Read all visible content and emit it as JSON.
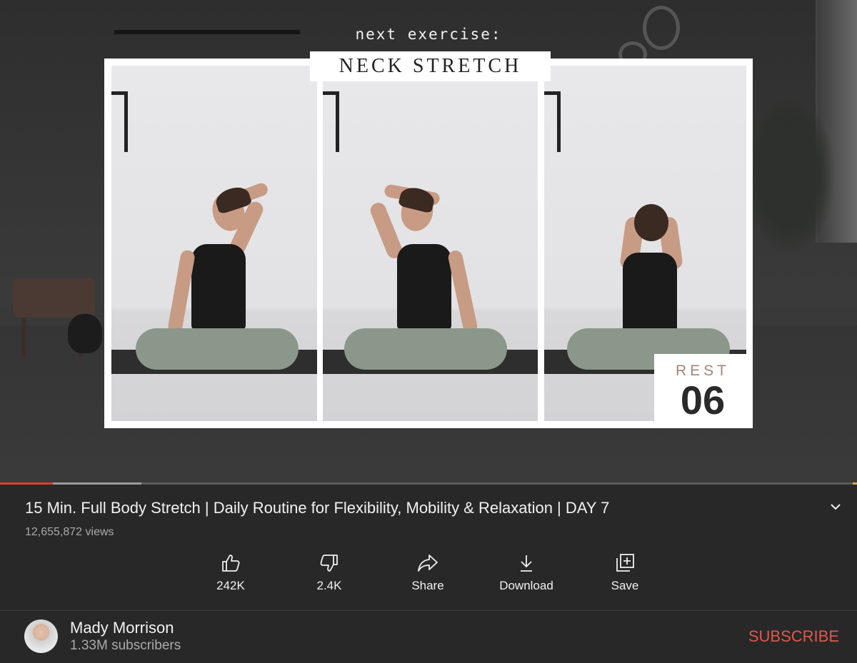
{
  "video": {
    "overlay_label": "next exercise:",
    "exercise_title": "NECK STRETCH",
    "rest_label": "REST",
    "rest_count": "06",
    "progress_played_fraction": 0.062,
    "progress_buffered_fraction": 0.165
  },
  "info": {
    "title": "15 Min. Full Body Stretch | Daily Routine for Flexibility, Mobility & Relaxation | DAY 7",
    "views": "12,655,872 views"
  },
  "actions": [
    {
      "label": "242K",
      "icon": "thumbs-up-icon"
    },
    {
      "label": "2.4K",
      "icon": "thumbs-down-icon"
    },
    {
      "label": "Share",
      "icon": "share-icon"
    },
    {
      "label": "Download",
      "icon": "download-icon"
    },
    {
      "label": "Save",
      "icon": "save-playlist-icon"
    }
  ],
  "channel": {
    "name": "Mady Morrison",
    "subscribers": "1.33M subscribers",
    "subscribe_label": "SUBSCRIBE"
  },
  "colors": {
    "background": "#282828",
    "accent": "#e0574b",
    "progress_played": "#e33b2e"
  }
}
